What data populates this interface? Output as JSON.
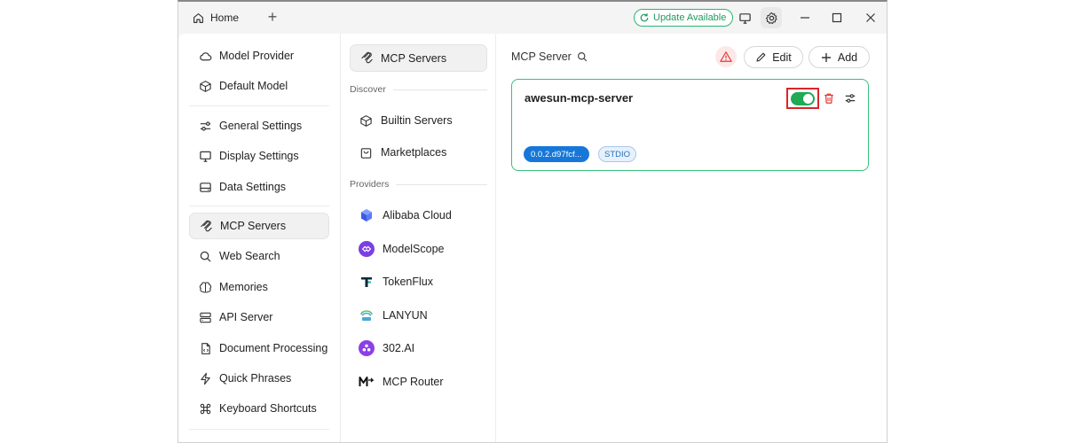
{
  "titlebar": {
    "home_tab": "Home",
    "add_tab": "+",
    "update_label": "Update Available"
  },
  "nav": {
    "items": [
      {
        "label": "Model Provider",
        "icon": "cloud-icon"
      },
      {
        "label": "Default Model",
        "icon": "cube-icon"
      },
      {
        "label": "General Settings",
        "icon": "sliders-icon"
      },
      {
        "label": "Display Settings",
        "icon": "monitor-icon"
      },
      {
        "label": "Data Settings",
        "icon": "hard-drive-icon"
      },
      {
        "label": "MCP Servers",
        "icon": "mcp-icon"
      },
      {
        "label": "Web Search",
        "icon": "search-icon"
      },
      {
        "label": "Memories",
        "icon": "brain-icon"
      },
      {
        "label": "API Server",
        "icon": "server-icon"
      },
      {
        "label": "Document Processing",
        "icon": "document-icon"
      },
      {
        "label": "Quick Phrases",
        "icon": "zap-icon"
      },
      {
        "label": "Keyboard Shortcuts",
        "icon": "command-icon"
      }
    ],
    "active": "MCP Servers"
  },
  "mid": {
    "active_label": "MCP Servers",
    "discover_heading": "Discover",
    "discover_items": [
      {
        "label": "Builtin Servers",
        "icon": "package-icon"
      },
      {
        "label": "Marketplaces",
        "icon": "shopping-bag-icon"
      }
    ],
    "providers_heading": "Providers",
    "providers": [
      {
        "label": "Alibaba Cloud",
        "color": "#4b6cf5"
      },
      {
        "label": "ModelScope",
        "color": "#7b3fe4"
      },
      {
        "label": "TokenFlux",
        "color": "#0a2a36"
      },
      {
        "label": "LANYUN",
        "color": "#3aa3a0"
      },
      {
        "label": "302.AI",
        "color": "#8c3fe8"
      },
      {
        "label": "MCP Router",
        "color": "#111111"
      }
    ]
  },
  "main": {
    "title": "MCP Server",
    "edit_label": "Edit",
    "add_label": "Add",
    "server": {
      "name": "awesun-mcp-server",
      "enabled": true,
      "version_tag": "0.0.2.d97fcf...",
      "type_tag": "STDIO"
    }
  },
  "colors": {
    "accent_green": "#1faa55",
    "update_green": "#2bb673",
    "highlight_red": "#d62828",
    "version_blue": "#1677d9"
  }
}
